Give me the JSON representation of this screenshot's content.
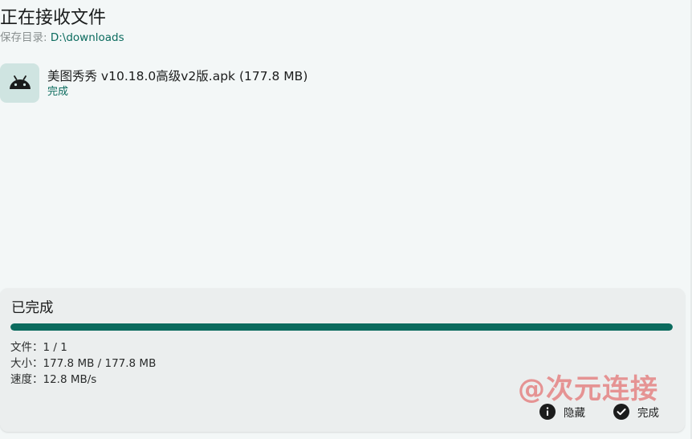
{
  "header": {
    "title": "正在接收文件",
    "save_label": "保存目录: ",
    "save_path": "D:\\downloads"
  },
  "files": [
    {
      "icon": "android-icon",
      "name": "美图秀秀 v10.18.0高级v2版.apk (177.8 MB)",
      "status": "完成"
    }
  ],
  "panel": {
    "status": "已完成",
    "progress_fraction": 1.0,
    "stats": {
      "files": "文件：1 / 1",
      "size": "大小：177.8 MB / 177.8 MB",
      "speed": "速度：12.8 MB/s"
    },
    "watermark": "@次元连接",
    "actions": {
      "hide": {
        "label": "隐藏",
        "icon": "info-icon"
      },
      "done": {
        "label": "完成",
        "icon": "check-circle-icon"
      }
    }
  },
  "colors": {
    "accent": "#0b6b5e",
    "progress_track": "#cfe4e1",
    "panel_bg": "#ebeeee",
    "page_bg": "#f3f7f7",
    "watermark": "#e58a8a"
  }
}
